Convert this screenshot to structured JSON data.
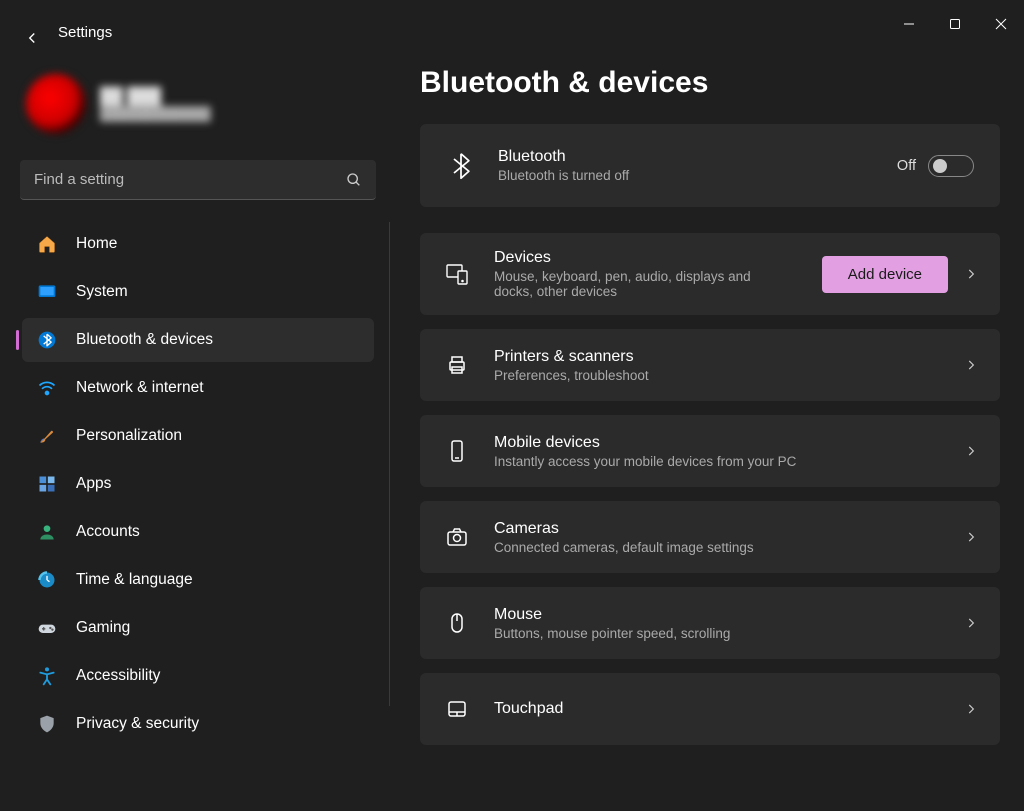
{
  "window": {
    "app_title": "Settings"
  },
  "profile": {
    "name": "██ ███",
    "sub": "████████████"
  },
  "search": {
    "placeholder": "Find a setting"
  },
  "sidebar": {
    "items": [
      {
        "label": "Home"
      },
      {
        "label": "System"
      },
      {
        "label": "Bluetooth & devices"
      },
      {
        "label": "Network & internet"
      },
      {
        "label": "Personalization"
      },
      {
        "label": "Apps"
      },
      {
        "label": "Accounts"
      },
      {
        "label": "Time & language"
      },
      {
        "label": "Gaming"
      },
      {
        "label": "Accessibility"
      },
      {
        "label": "Privacy & security"
      }
    ]
  },
  "main": {
    "title": "Bluetooth & devices",
    "bluetooth": {
      "title": "Bluetooth",
      "sub": "Bluetooth is turned off",
      "state_label": "Off"
    },
    "devices": {
      "title": "Devices",
      "sub": "Mouse, keyboard, pen, audio, displays and docks, other devices",
      "add_label": "Add device"
    },
    "printers": {
      "title": "Printers & scanners",
      "sub": "Preferences, troubleshoot"
    },
    "mobile": {
      "title": "Mobile devices",
      "sub": "Instantly access your mobile devices from your PC"
    },
    "cameras": {
      "title": "Cameras",
      "sub": "Connected cameras, default image settings"
    },
    "mouse": {
      "title": "Mouse",
      "sub": "Buttons, mouse pointer speed, scrolling"
    },
    "touchpad": {
      "title": "Touchpad"
    }
  }
}
